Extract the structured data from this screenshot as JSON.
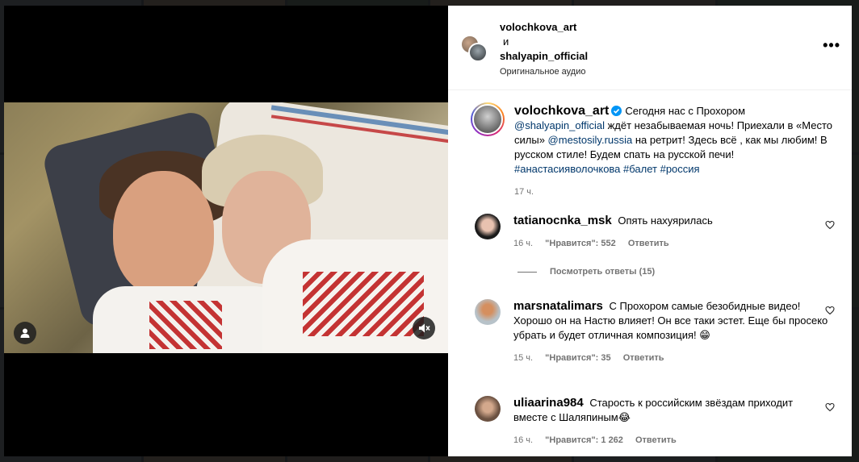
{
  "header": {
    "user1": "volochkova_art",
    "and": "и",
    "user2": "shalyapin_official",
    "audio": "Оригинальное аудио",
    "more": "•••"
  },
  "caption": {
    "username": "volochkova_art",
    "text_1": "Сегодня нас с Прохором ",
    "mention_1": "@shalyapin_official",
    "text_2": " ждёт незабываемая ночь! Приехали в «Место силы» ",
    "mention_2": "@mestosily.russia",
    "text_3": " на ретрит! Здесь всё , как мы любим! В русском стиле! Будем спать на русской печи! ",
    "hashtags": "#анастасияволочкова #балет #россия",
    "time": "17 ч."
  },
  "comments": [
    {
      "username": "tatianocnka_msk",
      "text": "Опять нахуярилась",
      "time": "16 ч.",
      "likes": "\"Нравится\": 552",
      "reply": "Ответить"
    },
    {
      "username": "marsnatalimars",
      "text": "С Прохором самые безобидные видео! Хорошо он на Настю влияет! Он все таки эстет. Еще бы просеко убрать и будет отличная композиция! 😁",
      "time": "15 ч.",
      "likes": "\"Нравится\": 35",
      "reply": "Ответить"
    },
    {
      "username": "uliaarina984",
      "text": "Старость к российским звёздам приходит вместе с Шаляпиным😂",
      "time": "16 ч.",
      "likes": "\"Нравится\": 1 262",
      "reply": "Ответить"
    }
  ],
  "view_replies": "Посмотреть ответы (15)",
  "icons": {
    "verified": "verified-badge-icon",
    "heart": "heart-outline-icon",
    "user": "user-tag-icon",
    "mute": "muted-speaker-icon"
  },
  "colors": {
    "link": "#00376b",
    "verified": "#0095f6",
    "muted_text": "#737373"
  }
}
